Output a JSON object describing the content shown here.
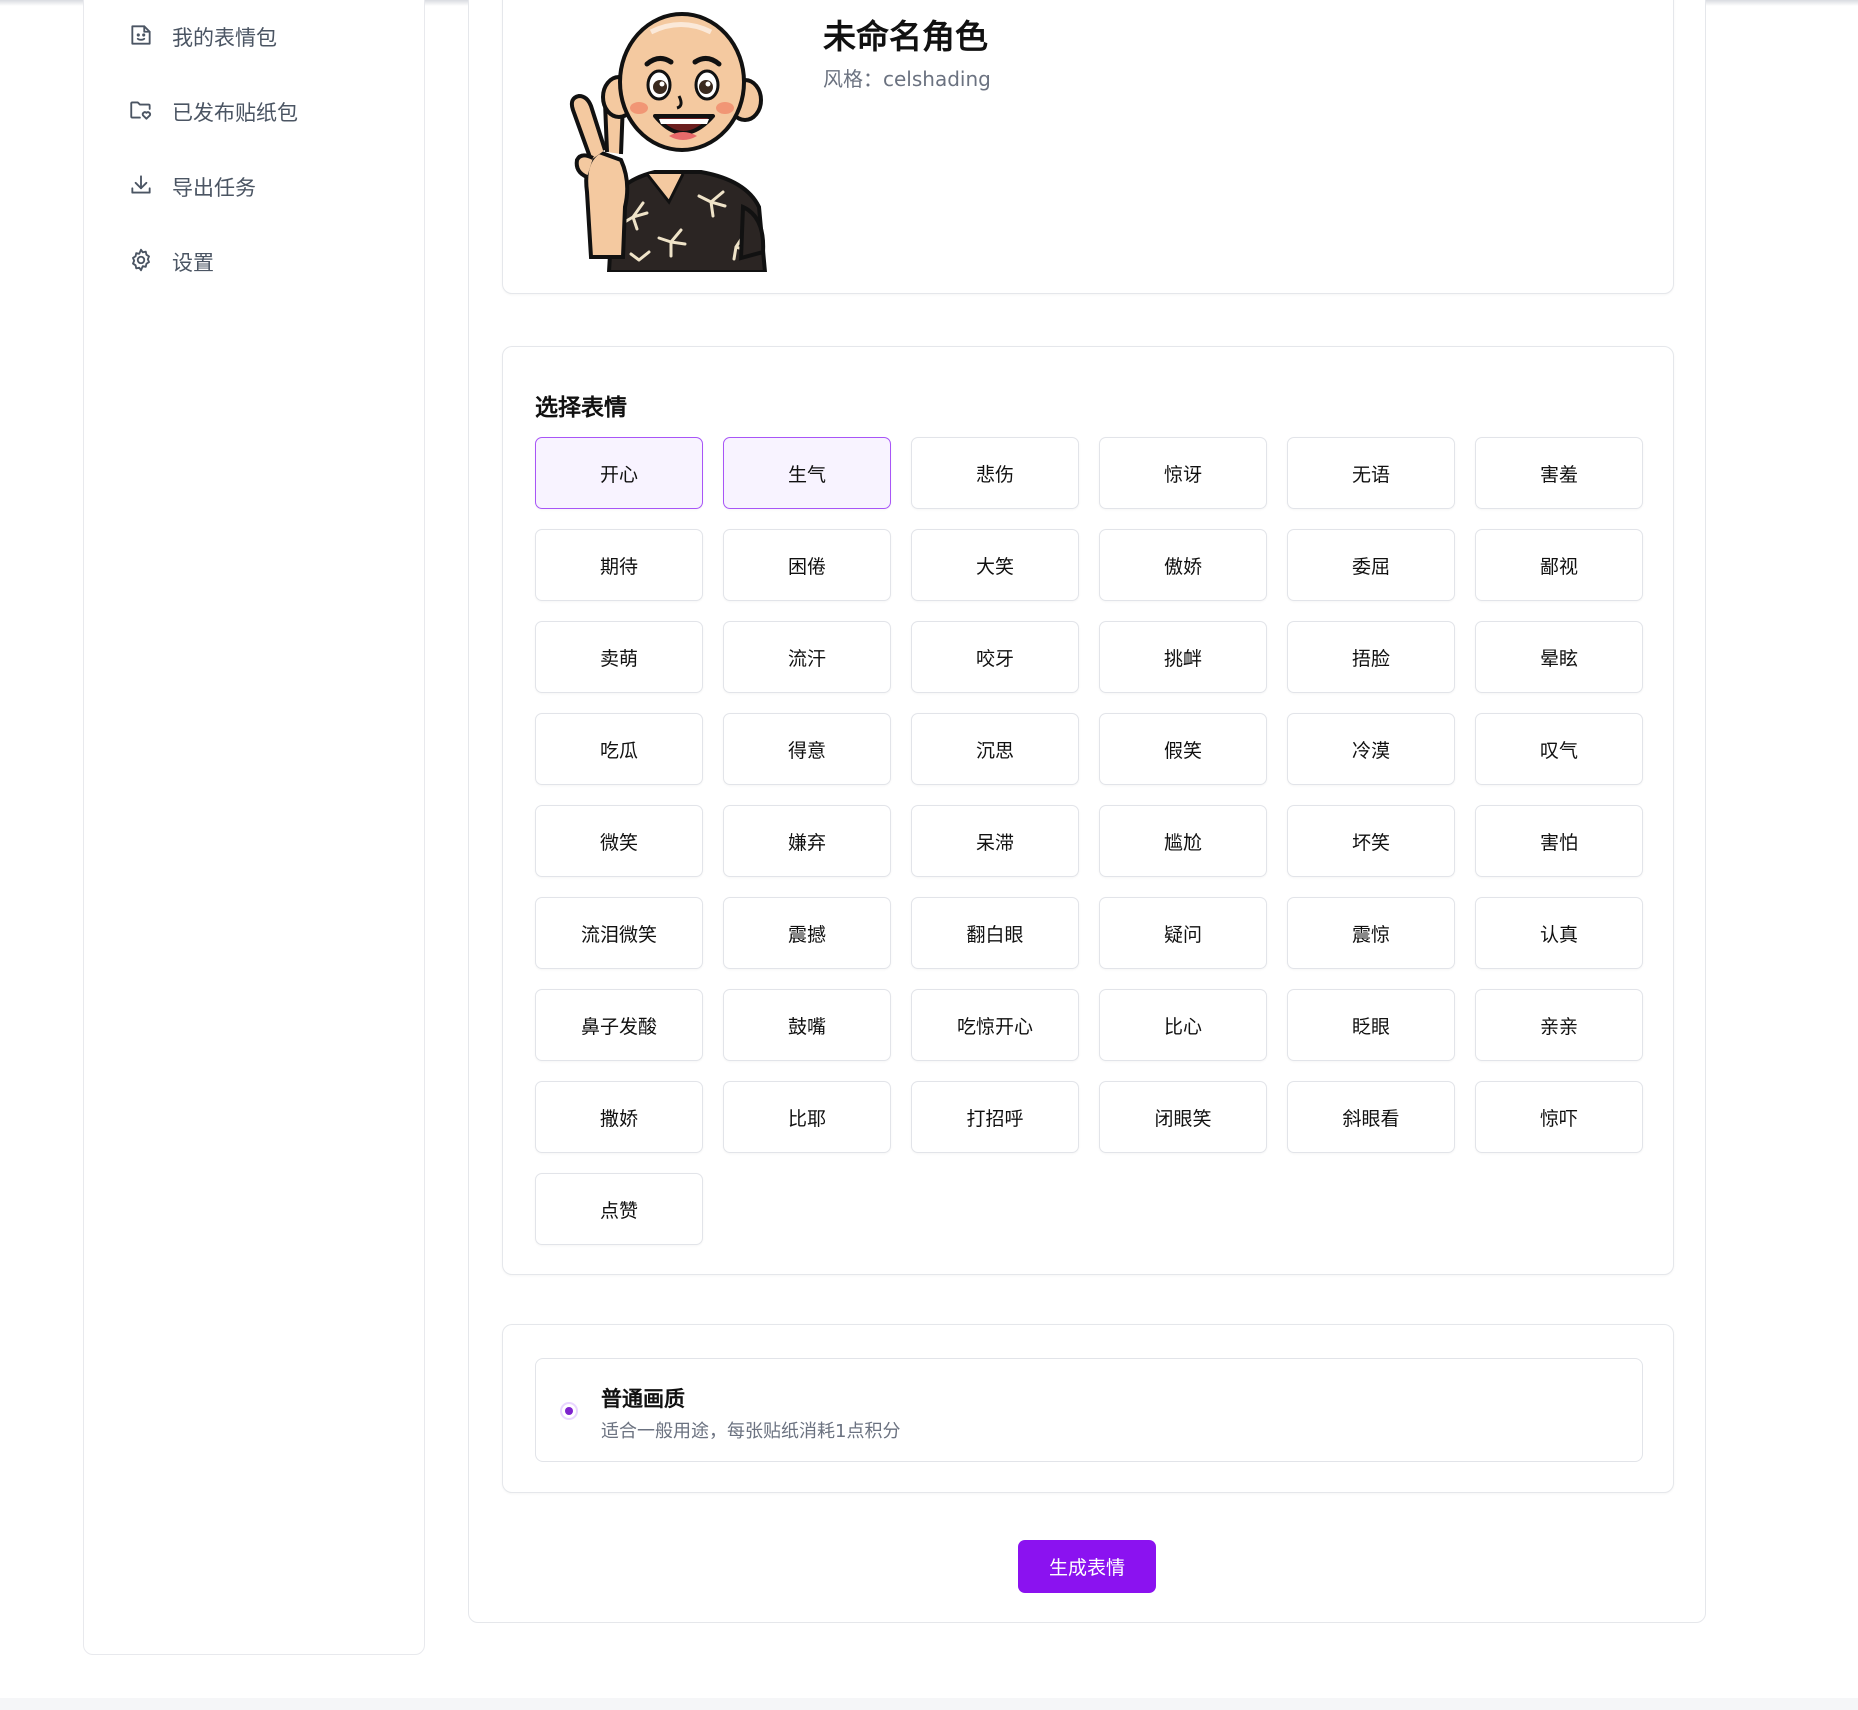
{
  "sidebar": {
    "items": [
      {
        "label": "我的表情包",
        "icon": "sticker-icon"
      },
      {
        "label": "已发布贴纸包",
        "icon": "folder-heart-icon"
      },
      {
        "label": "导出任务",
        "icon": "download-icon"
      },
      {
        "label": "设置",
        "icon": "gear-icon"
      }
    ]
  },
  "character": {
    "name": "未命名角色",
    "style": "风格：celshading",
    "avatar_icon": "cartoon-character-peace-sign"
  },
  "expressions": {
    "title": "选择表情",
    "items": [
      {
        "label": "开心",
        "selected": true
      },
      {
        "label": "生气",
        "selected": true
      },
      {
        "label": "悲伤",
        "selected": false
      },
      {
        "label": "惊讶",
        "selected": false
      },
      {
        "label": "无语",
        "selected": false
      },
      {
        "label": "害羞",
        "selected": false
      },
      {
        "label": "期待",
        "selected": false
      },
      {
        "label": "困倦",
        "selected": false
      },
      {
        "label": "大笑",
        "selected": false
      },
      {
        "label": "傲娇",
        "selected": false
      },
      {
        "label": "委屈",
        "selected": false
      },
      {
        "label": "鄙视",
        "selected": false
      },
      {
        "label": "卖萌",
        "selected": false
      },
      {
        "label": "流汗",
        "selected": false
      },
      {
        "label": "咬牙",
        "selected": false
      },
      {
        "label": "挑衅",
        "selected": false
      },
      {
        "label": "捂脸",
        "selected": false
      },
      {
        "label": "晕眩",
        "selected": false
      },
      {
        "label": "吃瓜",
        "selected": false
      },
      {
        "label": "得意",
        "selected": false
      },
      {
        "label": "沉思",
        "selected": false
      },
      {
        "label": "假笑",
        "selected": false
      },
      {
        "label": "冷漠",
        "selected": false
      },
      {
        "label": "叹气",
        "selected": false
      },
      {
        "label": "微笑",
        "selected": false
      },
      {
        "label": "嫌弃",
        "selected": false
      },
      {
        "label": "呆滞",
        "selected": false
      },
      {
        "label": "尴尬",
        "selected": false
      },
      {
        "label": "坏笑",
        "selected": false
      },
      {
        "label": "害怕",
        "selected": false
      },
      {
        "label": "流泪微笑",
        "selected": false
      },
      {
        "label": "震撼",
        "selected": false
      },
      {
        "label": "翻白眼",
        "selected": false
      },
      {
        "label": "疑问",
        "selected": false
      },
      {
        "label": "震惊",
        "selected": false
      },
      {
        "label": "认真",
        "selected": false
      },
      {
        "label": "鼻子发酸",
        "selected": false
      },
      {
        "label": "鼓嘴",
        "selected": false
      },
      {
        "label": "吃惊开心",
        "selected": false
      },
      {
        "label": "比心",
        "selected": false
      },
      {
        "label": "眨眼",
        "selected": false
      },
      {
        "label": "亲亲",
        "selected": false
      },
      {
        "label": "撒娇",
        "selected": false
      },
      {
        "label": "比耶",
        "selected": false
      },
      {
        "label": "打招呼",
        "selected": false
      },
      {
        "label": "闭眼笑",
        "selected": false
      },
      {
        "label": "斜眼看",
        "selected": false
      },
      {
        "label": "惊吓",
        "selected": false
      },
      {
        "label": "点赞",
        "selected": false
      }
    ]
  },
  "quality": {
    "title": "普通画质",
    "description": "适合一般用途，每张贴纸消耗1点积分",
    "selected": true
  },
  "actions": {
    "generate_label": "生成表情"
  },
  "colors": {
    "accent": "#8b12f0",
    "selected_border": "#a855f7",
    "selected_bg": "#f8f3ff"
  }
}
